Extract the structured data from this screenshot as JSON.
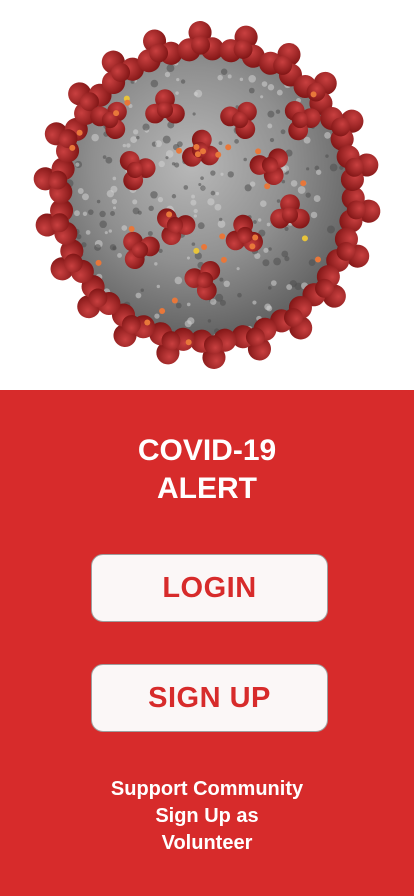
{
  "hero": {
    "image": "coronavirus-illustration"
  },
  "panel": {
    "background": "#d72b2b",
    "title_line1": "COVID-19",
    "title_line2": "ALERT",
    "login_label": "LOGIN",
    "signup_label": "SIGN UP",
    "volunteer_line1": "Support Community",
    "volunteer_line2": "Sign Up as",
    "volunteer_line3": "Volunteer"
  }
}
